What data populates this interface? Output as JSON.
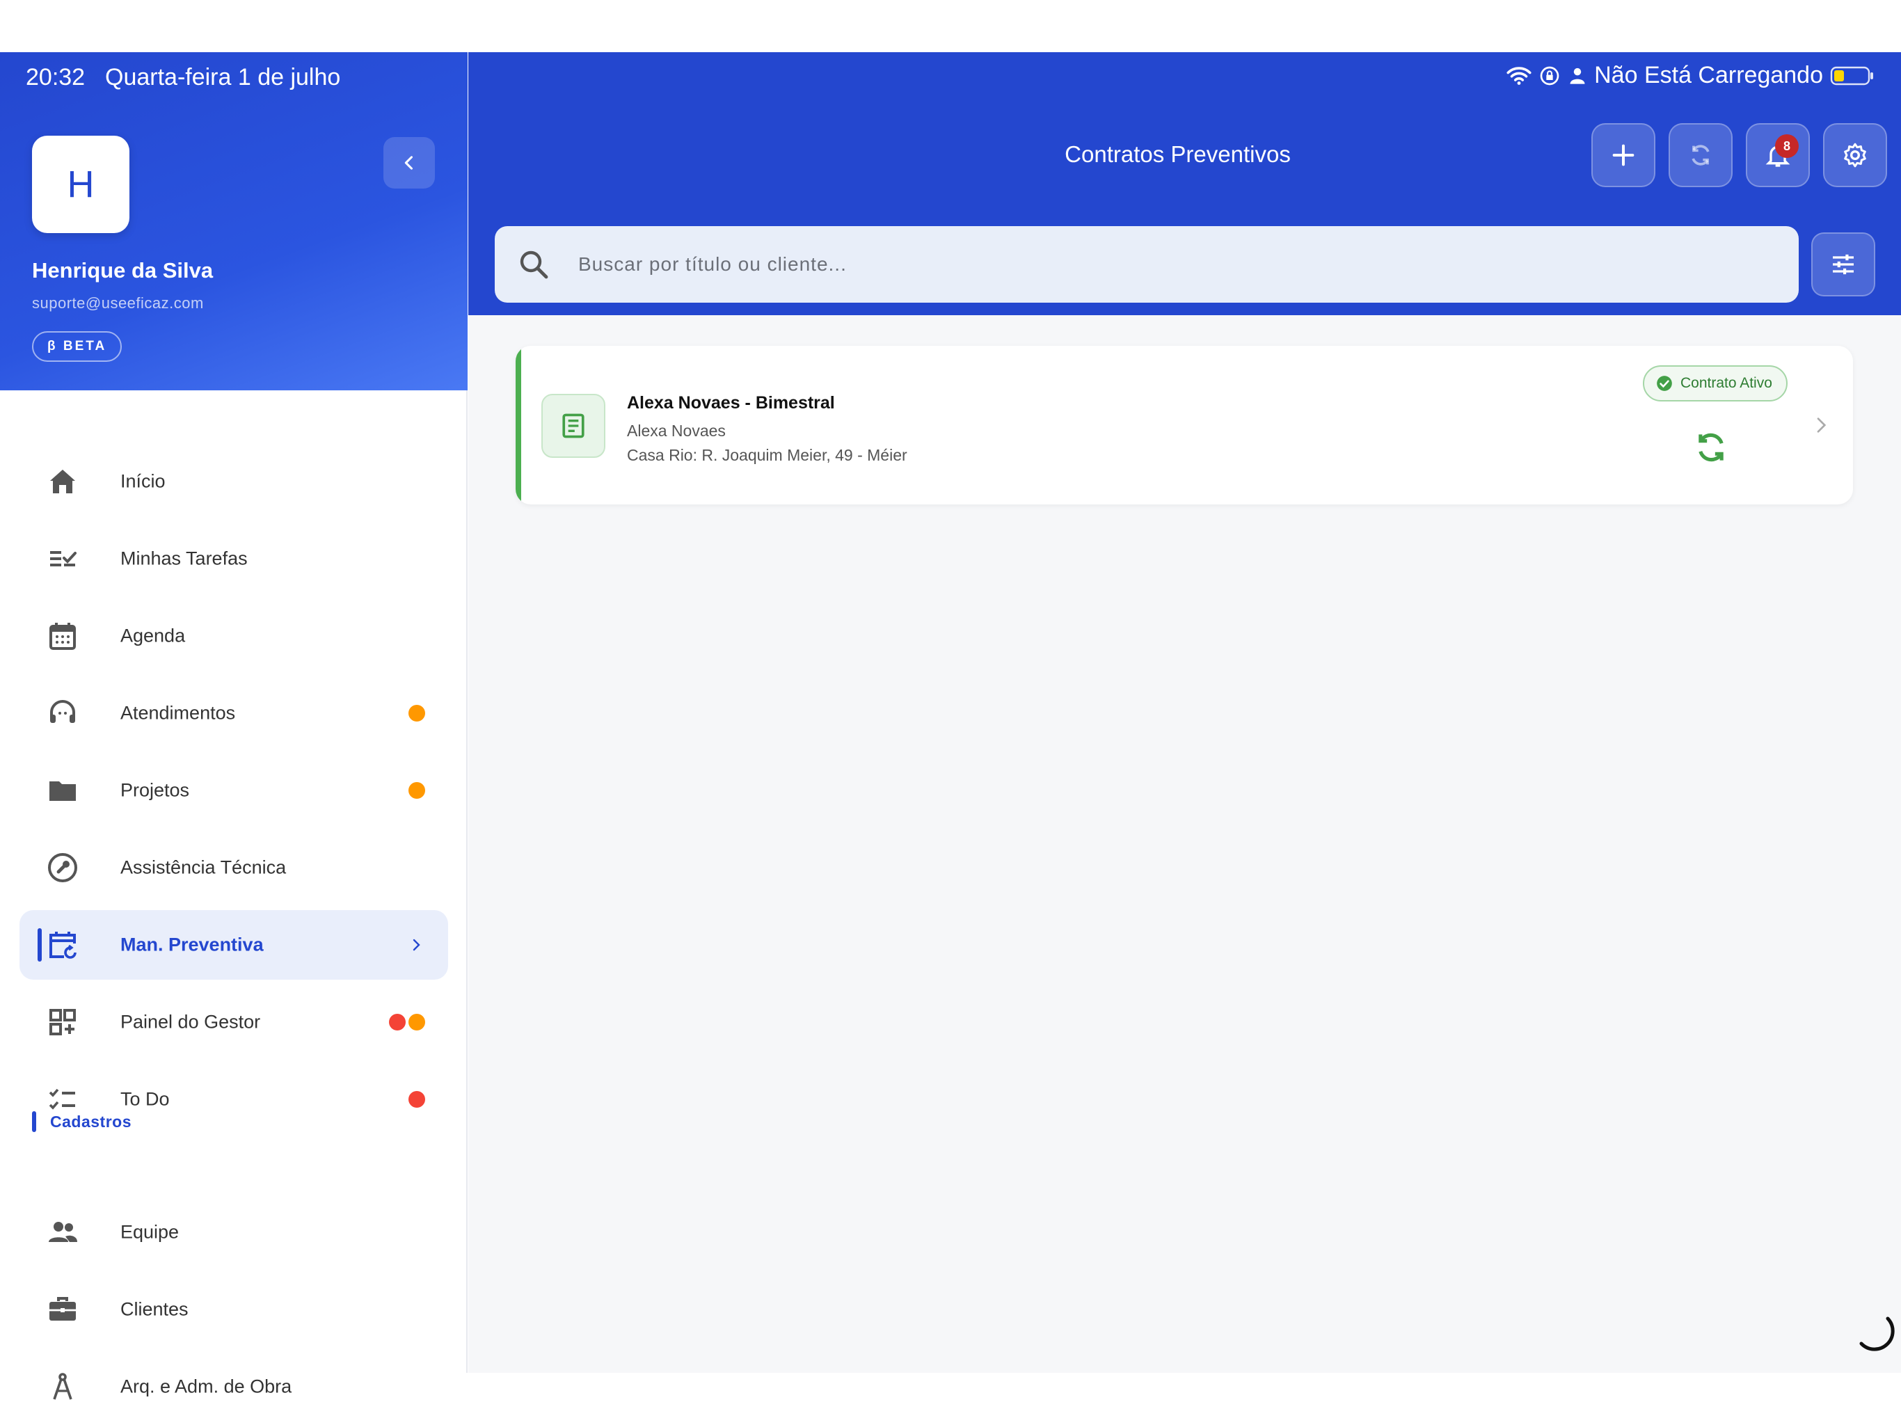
{
  "status_bar": {
    "time": "20:32",
    "date": "Quarta-feira 1 de julho",
    "battery_text": "Não Está Carregando"
  },
  "user": {
    "initial": "H",
    "name": "Henrique da Silva",
    "email": "suporte@useeficaz.com",
    "badge": "β  BETA"
  },
  "nav": {
    "items": [
      {
        "label": "Início",
        "icon": "home-icon"
      },
      {
        "label": "Minhas Tarefas",
        "icon": "checklist-icon"
      },
      {
        "label": "Agenda",
        "icon": "calendar-icon"
      },
      {
        "label": "Atendimentos",
        "icon": "headset-icon",
        "dots": [
          "orange"
        ]
      },
      {
        "label": "Projetos",
        "icon": "folder-icon",
        "dots": [
          "orange"
        ]
      },
      {
        "label": "Assistência Técnica",
        "icon": "wrench-icon"
      },
      {
        "label": "Man. Preventiva",
        "icon": "calendar-repeat-icon",
        "active": true
      },
      {
        "label": "Painel do Gestor",
        "icon": "dashboard-add-icon",
        "dots": [
          "red",
          "orange"
        ]
      },
      {
        "label": "To Do",
        "icon": "todo-list-icon",
        "dots": [
          "red"
        ]
      }
    ],
    "section_title": "Cadastros",
    "section_items": [
      {
        "label": "Equipe",
        "icon": "people-icon"
      },
      {
        "label": "Clientes",
        "icon": "briefcase-icon"
      },
      {
        "label": "Arq. e Adm. de Obra",
        "icon": "compass-icon"
      }
    ]
  },
  "header": {
    "title": "Contratos Preventivos",
    "notification_count": "8"
  },
  "search": {
    "placeholder": "Buscar por título ou cliente...",
    "value": ""
  },
  "contracts": [
    {
      "title": "Alexa Novaes - Bimestral",
      "client": "Alexa Novaes",
      "address": "Casa Rio: R. Joaquim Meier, 49 - Méier",
      "status": "Contrato Ativo"
    }
  ],
  "colors": {
    "primary": "#2447cf",
    "active_green": "#4caf50",
    "dot_orange": "#ff9800",
    "dot_red": "#f44336"
  }
}
